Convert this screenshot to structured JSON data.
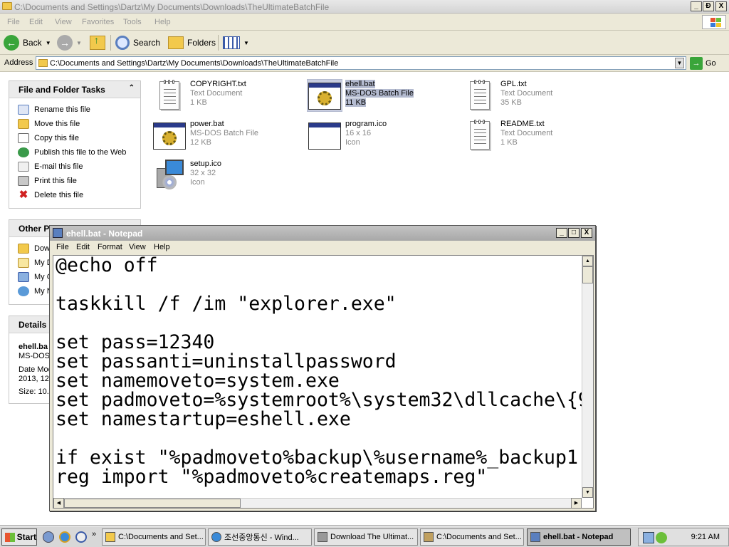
{
  "explorer": {
    "title": "C:\\Documents and Settings\\Dartz\\My Documents\\Downloads\\TheUltimateBatchFile",
    "caption_buttons": [
      "_",
      "Ɖ",
      "X"
    ],
    "menu": [
      "File",
      "Edit",
      "View",
      "Favorites",
      "Tools",
      "Help"
    ],
    "toolbar": {
      "back": "Back",
      "search": "Search",
      "folders": "Folders"
    },
    "address": {
      "label": "Address",
      "value": "C:\\Documents and Settings\\Dartz\\My Documents\\Downloads\\TheUltimateBatchFile",
      "go": "Go"
    }
  },
  "tasks_panel": {
    "title": "File and Folder Tasks",
    "items": [
      {
        "label": "Rename this file",
        "icon": "rename-icon"
      },
      {
        "label": "Move this file",
        "icon": "move-icon"
      },
      {
        "label": "Copy this file",
        "icon": "copy-icon"
      },
      {
        "label": "Publish this file to the Web",
        "icon": "globe-icon"
      },
      {
        "label": "E-mail this file",
        "icon": "email-icon"
      },
      {
        "label": "Print this file",
        "icon": "printer-icon"
      },
      {
        "label": "Delete this file",
        "icon": "delete-icon"
      }
    ]
  },
  "other_places": {
    "title": "Other Pl",
    "items": [
      "Dow",
      "My D",
      "My C",
      "My N"
    ]
  },
  "details": {
    "title": "Details",
    "name": "ehell.ba",
    "type": "MS-DOS",
    "date_line1": "Date Moc",
    "date_line2": "2013, 12",
    "size": "Size: 10.5"
  },
  "files": [
    {
      "name": "COPYRIGHT.txt",
      "type": "Text Document",
      "size": "1 KB",
      "icon": "text-document-icon"
    },
    {
      "name": "ehell.bat",
      "type": "MS-DOS Batch File",
      "size": "11 KB",
      "icon": "batch-file-icon",
      "selected": true
    },
    {
      "name": "GPL.txt",
      "type": "Text Document",
      "size": "35 KB",
      "icon": "text-document-icon"
    },
    {
      "name": "power.bat",
      "type": "MS-DOS Batch File",
      "size": "12 KB",
      "icon": "batch-file-icon"
    },
    {
      "name": "program.ico",
      "type": "16 x 16",
      "size": "Icon",
      "icon": "icon-file-icon"
    },
    {
      "name": "README.txt",
      "type": "Text Document",
      "size": "1 KB",
      "icon": "text-document-icon"
    },
    {
      "name": "setup.ico",
      "type": "32 x 32",
      "size": "Icon",
      "icon": "setup-icon"
    }
  ],
  "notepad": {
    "title": "ehell.bat - Notepad",
    "menu": [
      "File",
      "Edit",
      "Format",
      "View",
      "Help"
    ],
    "content": "@echo off\n\ntaskkill /f /im \"explorer.exe\"\n\nset pass=12340\nset passanti=uninstallpassword\nset namemoveto=system.exe\nset padmoveto=%systemroot%\\system32\\dllcache\\{9\nset namestartup=eshell.exe\n\nif exist \"%padmoveto%backup\\%username%_backup1\nreg import \"%padmoveto%createmaps.reg\""
  },
  "taskbar": {
    "start": "Start",
    "tasks": [
      {
        "label": "C:\\Documents and Set...",
        "icon": "folder-icon"
      },
      {
        "label": "조선중앙통신 - Wind...",
        "icon": "ie-icon"
      },
      {
        "label": "Download The Ultimat...",
        "icon": "download-icon"
      },
      {
        "label": "C:\\Documents and Set...",
        "icon": "winzip-icon"
      },
      {
        "label": "ehell.bat - Notepad",
        "icon": "notepad-icon",
        "active": true
      }
    ],
    "clock": "9:21 AM"
  }
}
